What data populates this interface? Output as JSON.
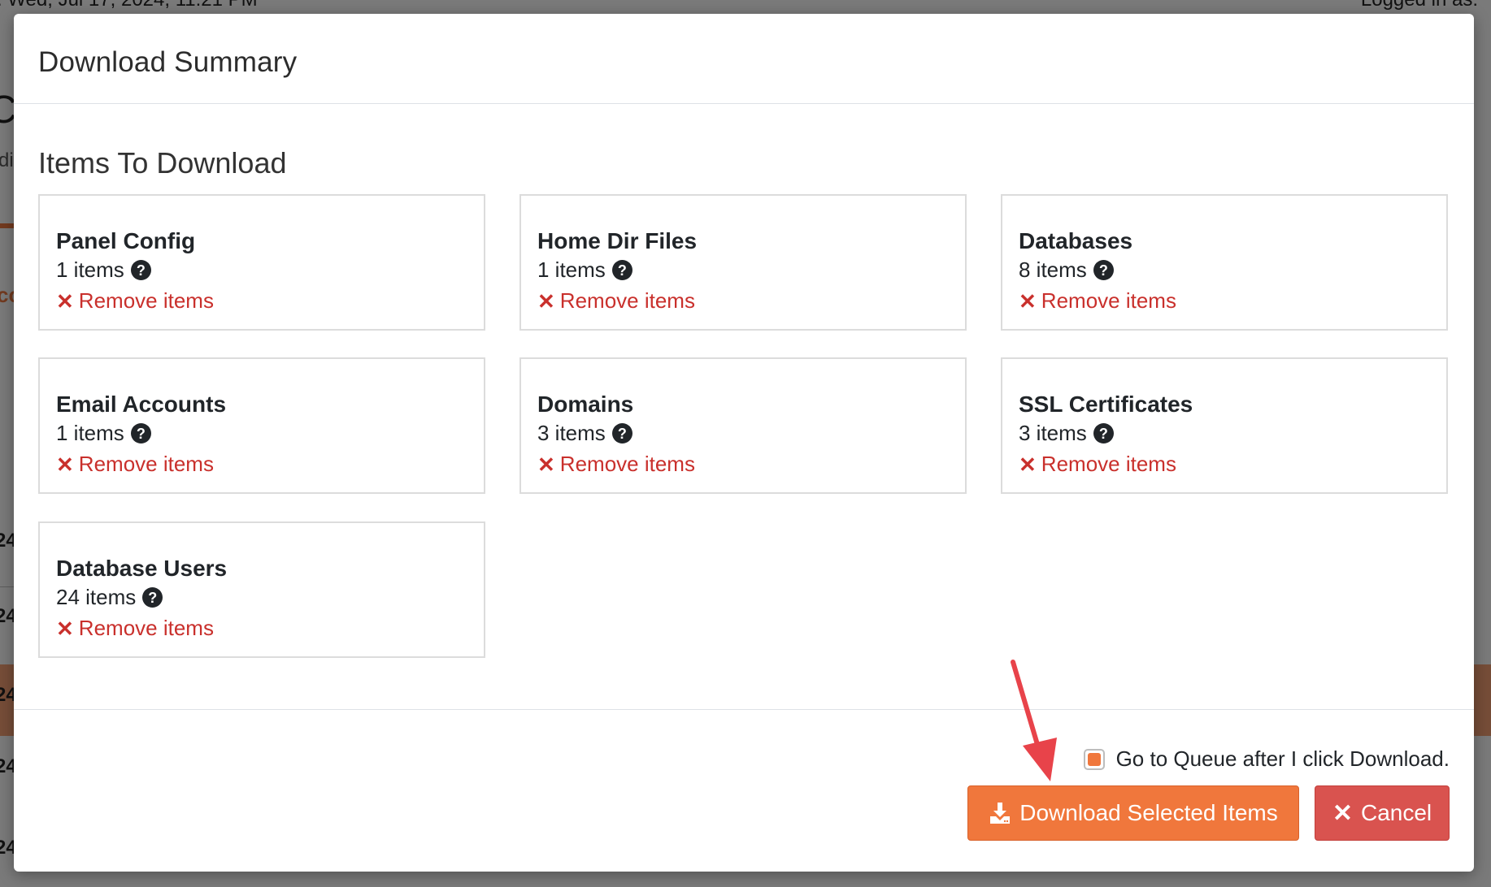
{
  "background": {
    "top_left_text": ": Wed, Jul 17, 2024, 11:21 PM",
    "top_right_text": "Logged in as:",
    "letter_c": "C",
    "text_di": "di",
    "text_co": "co",
    "row_prefix": "24"
  },
  "modal": {
    "title": "Download Summary",
    "section_title": "Items To Download",
    "remove_label": "Remove items",
    "cards": [
      {
        "title": "Panel Config",
        "count": "1 items"
      },
      {
        "title": "Home Dir Files",
        "count": "1 items"
      },
      {
        "title": "Databases",
        "count": "8 items"
      },
      {
        "title": "Email Accounts",
        "count": "1 items"
      },
      {
        "title": "Domains",
        "count": "3 items"
      },
      {
        "title": "SSL Certificates",
        "count": "3 items"
      },
      {
        "title": "Database Users",
        "count": "24 items"
      }
    ],
    "queue_checkbox_label": "Go to Queue after I click Download.",
    "queue_checked": true,
    "download_button": "Download Selected Items",
    "cancel_button": "Cancel"
  },
  "colors": {
    "primary_orange": "#f0773c",
    "danger_red": "#d9534f",
    "remove_red": "#c9302c",
    "annotation_arrow": "#e8434a"
  }
}
